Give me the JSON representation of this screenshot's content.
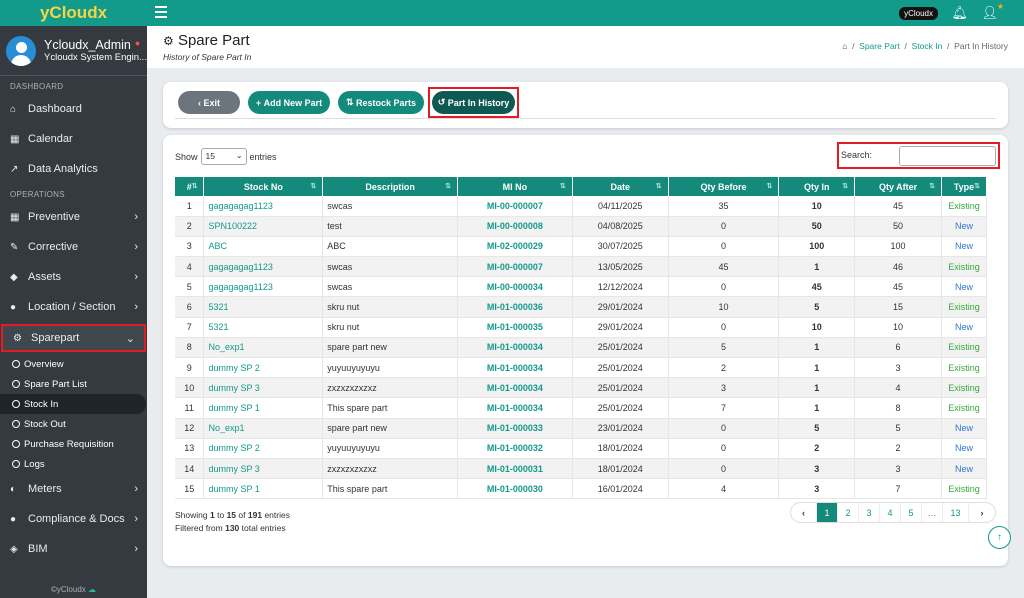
{
  "brand": "yCloudx",
  "user": {
    "name": "Ycloudx_Admin",
    "role": "Ycloudx System Engin..."
  },
  "sidebar": {
    "section1": "DASHBOARD",
    "items1": [
      {
        "label": "Dashboard",
        "icon": "home-icon"
      },
      {
        "label": "Calendar",
        "icon": "calendar-icon"
      },
      {
        "label": "Data Analytics",
        "icon": "chart-icon"
      }
    ],
    "section2": "OPERATIONS",
    "items2": [
      {
        "label": "Preventive",
        "icon": "calendar-icon"
      },
      {
        "label": "Corrective",
        "icon": "wrench-icon"
      },
      {
        "label": "Assets",
        "icon": "tag-icon"
      },
      {
        "label": "Location / Section",
        "icon": "globe-icon"
      },
      {
        "label": "Sparepart",
        "icon": "gears-icon"
      }
    ],
    "subitems": [
      "Overview",
      "Spare Part List",
      "Stock In",
      "Stock Out",
      "Purchase Requisition",
      "Logs"
    ],
    "items3": [
      {
        "label": "Meters",
        "icon": "tachometer-icon"
      },
      {
        "label": "Compliance & Docs",
        "icon": "circle-icon"
      },
      {
        "label": "BIM",
        "icon": "cube-icon"
      }
    ],
    "footer": "©yCloudx"
  },
  "topbar": {
    "badge": "yCloudx"
  },
  "page": {
    "title": "Spare Part",
    "subtitle": "History of Spare Part In",
    "breadcrumb": [
      "Spare Part",
      "Stock In",
      "Part In History"
    ]
  },
  "toolbar": {
    "exit": "Exit",
    "add": "Add New Part",
    "restock": "Restock Parts",
    "history": "Part In History"
  },
  "table_controls": {
    "show": "Show",
    "entries_value": "15",
    "entries": "entries",
    "search": "Search:"
  },
  "columns": [
    "#",
    "Stock No",
    "Description",
    "MI No",
    "Date",
    "Qty Before",
    "Qty In",
    "Qty After",
    "Type"
  ],
  "rows": [
    [
      "1",
      "gagagagag1123",
      "swcas",
      "MI-00-000007",
      "04/11/2025",
      "35",
      "10",
      "45",
      "Existing"
    ],
    [
      "2",
      "SPN100222",
      "test",
      "MI-00-000008",
      "04/08/2025",
      "0",
      "50",
      "50",
      "New"
    ],
    [
      "3",
      "ABC",
      "ABC",
      "MI-02-000029",
      "30/07/2025",
      "0",
      "100",
      "100",
      "New"
    ],
    [
      "4",
      "gagagagag1123",
      "swcas",
      "MI-00-000007",
      "13/05/2025",
      "45",
      "1",
      "46",
      "Existing"
    ],
    [
      "5",
      "gagagagag1123",
      "swcas",
      "MI-00-000034",
      "12/12/2024",
      "0",
      "45",
      "45",
      "New"
    ],
    [
      "6",
      "5321",
      "skru nut",
      "MI-01-000036",
      "29/01/2024",
      "10",
      "5",
      "15",
      "Existing"
    ],
    [
      "7",
      "5321",
      "skru nut",
      "MI-01-000035",
      "29/01/2024",
      "0",
      "10",
      "10",
      "New"
    ],
    [
      "8",
      "No_exp1",
      "spare part new",
      "MI-01-000034",
      "25/01/2024",
      "5",
      "1",
      "6",
      "Existing"
    ],
    [
      "9",
      "dummy SP 2",
      "yuyuuyuyuyu",
      "MI-01-000034",
      "25/01/2024",
      "2",
      "1",
      "3",
      "Existing"
    ],
    [
      "10",
      "dummy SP 3",
      "zxzxzxzxzxz",
      "MI-01-000034",
      "25/01/2024",
      "3",
      "1",
      "4",
      "Existing"
    ],
    [
      "11",
      "dummy SP 1",
      "This spare part",
      "MI-01-000034",
      "25/01/2024",
      "7",
      "1",
      "8",
      "Existing"
    ],
    [
      "12",
      "No_exp1",
      "spare part new",
      "MI-01-000033",
      "23/01/2024",
      "0",
      "5",
      "5",
      "New"
    ],
    [
      "13",
      "dummy SP 2",
      "yuyuuyuyuyu",
      "MI-01-000032",
      "18/01/2024",
      "0",
      "2",
      "2",
      "New"
    ],
    [
      "14",
      "dummy SP 3",
      "zxzxzxzxzxz",
      "MI-01-000031",
      "18/01/2024",
      "0",
      "3",
      "3",
      "New"
    ],
    [
      "15",
      "dummy SP 1",
      "This spare part",
      "MI-01-000030",
      "16/01/2024",
      "4",
      "3",
      "7",
      "Existing"
    ]
  ],
  "info": {
    "showing": "Showing",
    "from": "1",
    "to_word": "to",
    "to": "15",
    "of_word": "of",
    "total": "191",
    "entries": "entries",
    "filtered": "Filtered from",
    "filtered_total": "130",
    "filtered_end": "total entries"
  },
  "pagination": {
    "prev": "‹",
    "pages": [
      "1",
      "2",
      "3",
      "4",
      "5",
      "…",
      "13"
    ],
    "next": "›"
  }
}
